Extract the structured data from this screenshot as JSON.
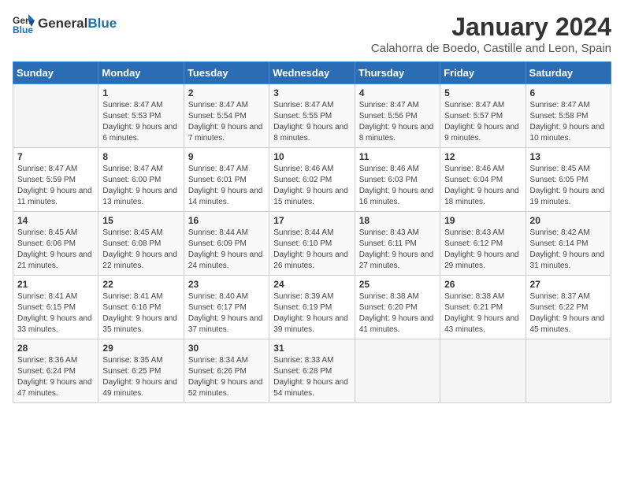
{
  "logo": {
    "general": "General",
    "blue": "Blue"
  },
  "header": {
    "month": "January 2024",
    "location": "Calahorra de Boedo, Castille and Leon, Spain"
  },
  "weekdays": [
    "Sunday",
    "Monday",
    "Tuesday",
    "Wednesday",
    "Thursday",
    "Friday",
    "Saturday"
  ],
  "weeks": [
    [
      {
        "day": "",
        "sunrise": "",
        "sunset": "",
        "daylight": ""
      },
      {
        "day": "1",
        "sunrise": "Sunrise: 8:47 AM",
        "sunset": "Sunset: 5:53 PM",
        "daylight": "Daylight: 9 hours and 6 minutes."
      },
      {
        "day": "2",
        "sunrise": "Sunrise: 8:47 AM",
        "sunset": "Sunset: 5:54 PM",
        "daylight": "Daylight: 9 hours and 7 minutes."
      },
      {
        "day": "3",
        "sunrise": "Sunrise: 8:47 AM",
        "sunset": "Sunset: 5:55 PM",
        "daylight": "Daylight: 9 hours and 8 minutes."
      },
      {
        "day": "4",
        "sunrise": "Sunrise: 8:47 AM",
        "sunset": "Sunset: 5:56 PM",
        "daylight": "Daylight: 9 hours and 8 minutes."
      },
      {
        "day": "5",
        "sunrise": "Sunrise: 8:47 AM",
        "sunset": "Sunset: 5:57 PM",
        "daylight": "Daylight: 9 hours and 9 minutes."
      },
      {
        "day": "6",
        "sunrise": "Sunrise: 8:47 AM",
        "sunset": "Sunset: 5:58 PM",
        "daylight": "Daylight: 9 hours and 10 minutes."
      }
    ],
    [
      {
        "day": "7",
        "sunrise": "Sunrise: 8:47 AM",
        "sunset": "Sunset: 5:59 PM",
        "daylight": "Daylight: 9 hours and 11 minutes."
      },
      {
        "day": "8",
        "sunrise": "Sunrise: 8:47 AM",
        "sunset": "Sunset: 6:00 PM",
        "daylight": "Daylight: 9 hours and 13 minutes."
      },
      {
        "day": "9",
        "sunrise": "Sunrise: 8:47 AM",
        "sunset": "Sunset: 6:01 PM",
        "daylight": "Daylight: 9 hours and 14 minutes."
      },
      {
        "day": "10",
        "sunrise": "Sunrise: 8:46 AM",
        "sunset": "Sunset: 6:02 PM",
        "daylight": "Daylight: 9 hours and 15 minutes."
      },
      {
        "day": "11",
        "sunrise": "Sunrise: 8:46 AM",
        "sunset": "Sunset: 6:03 PM",
        "daylight": "Daylight: 9 hours and 16 minutes."
      },
      {
        "day": "12",
        "sunrise": "Sunrise: 8:46 AM",
        "sunset": "Sunset: 6:04 PM",
        "daylight": "Daylight: 9 hours and 18 minutes."
      },
      {
        "day": "13",
        "sunrise": "Sunrise: 8:45 AM",
        "sunset": "Sunset: 6:05 PM",
        "daylight": "Daylight: 9 hours and 19 minutes."
      }
    ],
    [
      {
        "day": "14",
        "sunrise": "Sunrise: 8:45 AM",
        "sunset": "Sunset: 6:06 PM",
        "daylight": "Daylight: 9 hours and 21 minutes."
      },
      {
        "day": "15",
        "sunrise": "Sunrise: 8:45 AM",
        "sunset": "Sunset: 6:08 PM",
        "daylight": "Daylight: 9 hours and 22 minutes."
      },
      {
        "day": "16",
        "sunrise": "Sunrise: 8:44 AM",
        "sunset": "Sunset: 6:09 PM",
        "daylight": "Daylight: 9 hours and 24 minutes."
      },
      {
        "day": "17",
        "sunrise": "Sunrise: 8:44 AM",
        "sunset": "Sunset: 6:10 PM",
        "daylight": "Daylight: 9 hours and 26 minutes."
      },
      {
        "day": "18",
        "sunrise": "Sunrise: 8:43 AM",
        "sunset": "Sunset: 6:11 PM",
        "daylight": "Daylight: 9 hours and 27 minutes."
      },
      {
        "day": "19",
        "sunrise": "Sunrise: 8:43 AM",
        "sunset": "Sunset: 6:12 PM",
        "daylight": "Daylight: 9 hours and 29 minutes."
      },
      {
        "day": "20",
        "sunrise": "Sunrise: 8:42 AM",
        "sunset": "Sunset: 6:14 PM",
        "daylight": "Daylight: 9 hours and 31 minutes."
      }
    ],
    [
      {
        "day": "21",
        "sunrise": "Sunrise: 8:41 AM",
        "sunset": "Sunset: 6:15 PM",
        "daylight": "Daylight: 9 hours and 33 minutes."
      },
      {
        "day": "22",
        "sunrise": "Sunrise: 8:41 AM",
        "sunset": "Sunset: 6:16 PM",
        "daylight": "Daylight: 9 hours and 35 minutes."
      },
      {
        "day": "23",
        "sunrise": "Sunrise: 8:40 AM",
        "sunset": "Sunset: 6:17 PM",
        "daylight": "Daylight: 9 hours and 37 minutes."
      },
      {
        "day": "24",
        "sunrise": "Sunrise: 8:39 AM",
        "sunset": "Sunset: 6:19 PM",
        "daylight": "Daylight: 9 hours and 39 minutes."
      },
      {
        "day": "25",
        "sunrise": "Sunrise: 8:38 AM",
        "sunset": "Sunset: 6:20 PM",
        "daylight": "Daylight: 9 hours and 41 minutes."
      },
      {
        "day": "26",
        "sunrise": "Sunrise: 8:38 AM",
        "sunset": "Sunset: 6:21 PM",
        "daylight": "Daylight: 9 hours and 43 minutes."
      },
      {
        "day": "27",
        "sunrise": "Sunrise: 8:37 AM",
        "sunset": "Sunset: 6:22 PM",
        "daylight": "Daylight: 9 hours and 45 minutes."
      }
    ],
    [
      {
        "day": "28",
        "sunrise": "Sunrise: 8:36 AM",
        "sunset": "Sunset: 6:24 PM",
        "daylight": "Daylight: 9 hours and 47 minutes."
      },
      {
        "day": "29",
        "sunrise": "Sunrise: 8:35 AM",
        "sunset": "Sunset: 6:25 PM",
        "daylight": "Daylight: 9 hours and 49 minutes."
      },
      {
        "day": "30",
        "sunrise": "Sunrise: 8:34 AM",
        "sunset": "Sunset: 6:26 PM",
        "daylight": "Daylight: 9 hours and 52 minutes."
      },
      {
        "day": "31",
        "sunrise": "Sunrise: 8:33 AM",
        "sunset": "Sunset: 6:28 PM",
        "daylight": "Daylight: 9 hours and 54 minutes."
      },
      {
        "day": "",
        "sunrise": "",
        "sunset": "",
        "daylight": ""
      },
      {
        "day": "",
        "sunrise": "",
        "sunset": "",
        "daylight": ""
      },
      {
        "day": "",
        "sunrise": "",
        "sunset": "",
        "daylight": ""
      }
    ]
  ]
}
